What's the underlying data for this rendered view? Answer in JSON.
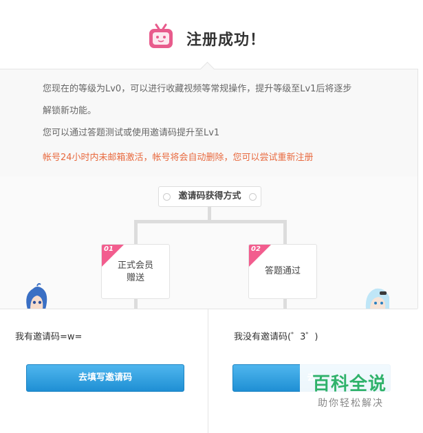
{
  "header": {
    "title": "注册成功！",
    "icon": "tv-icon",
    "accent": "#e85b8c"
  },
  "info": {
    "line1": "您现在的等级为Lv0，可以进行收藏视频等常规操作，提升等级至Lv1后将逐步",
    "line2": "解锁新功能。",
    "line3": "您可以通过答题测试或使用邀请码提升至Lv1",
    "warning": "帐号24小时内未邮箱激活，帐号将会自动删除，您可以尝试重新注册",
    "warning_color": "#e8693e"
  },
  "methods": {
    "title": "邀请码获得方式",
    "cards": [
      {
        "num": "01",
        "line1": "正式会员",
        "line2": "赠送"
      },
      {
        "num": "02",
        "line1": "答题通过",
        "line2": ""
      }
    ]
  },
  "left_panel": {
    "question": "我有邀请码=w=",
    "button": "去填写邀请码"
  },
  "right_panel": {
    "question": "我没有邀请码(゜3゜)",
    "button": "去"
  },
  "watermark": {
    "title": "百科全说",
    "subtitle": "助你轻松解决"
  }
}
